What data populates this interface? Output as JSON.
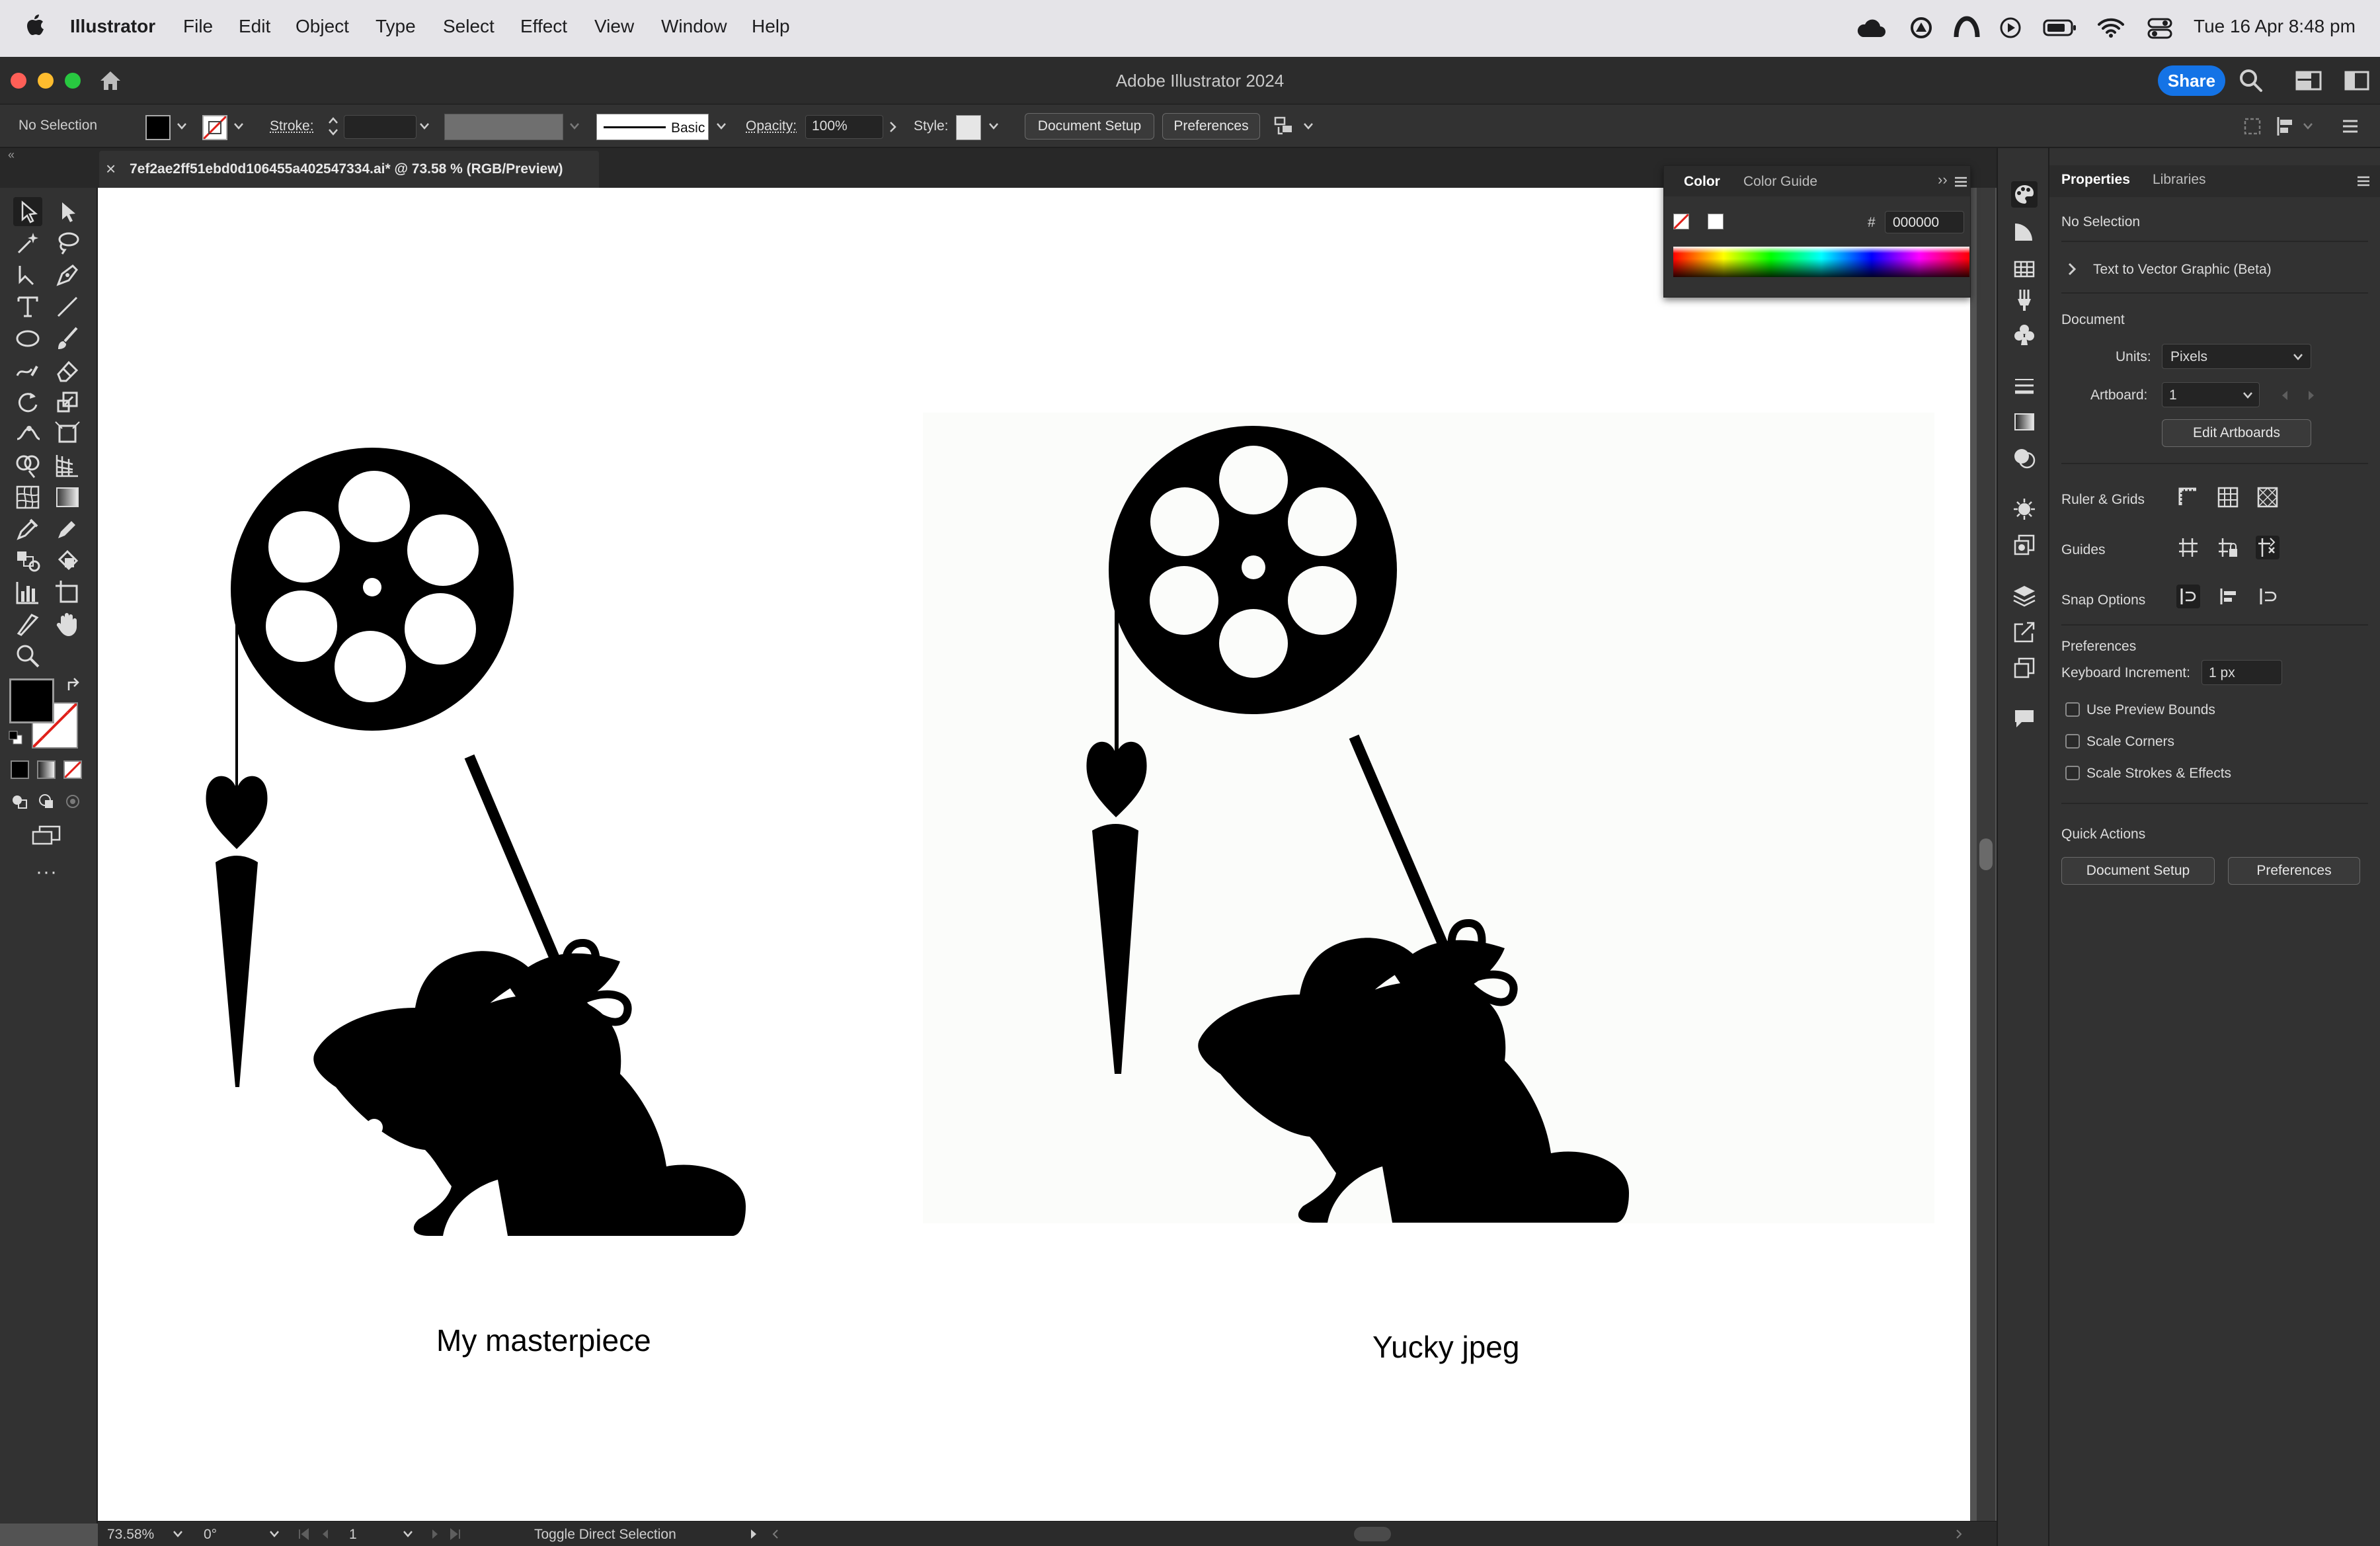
{
  "menubar": {
    "app_name": "Illustrator",
    "items": [
      "File",
      "Edit",
      "Object",
      "Type",
      "Select",
      "Effect",
      "View",
      "Window",
      "Help"
    ],
    "clock": "Tue 16 Apr  8:48 pm"
  },
  "window": {
    "title": "Adobe Illustrator 2024",
    "share_label": "Share"
  },
  "controlbar": {
    "selection_status": "No Selection",
    "stroke_label": "Stroke:",
    "brush_label": "Basic",
    "opacity_label": "Opacity:",
    "opacity_value": "100%",
    "style_label": "Style:",
    "document_setup_label": "Document Setup",
    "preferences_label": "Preferences"
  },
  "document_tab": {
    "title": "7ef2ae2ff51ebd0d106455a402547334.ai* @ 73.58 % (RGB/Preview)",
    "close_glyph": "×"
  },
  "artboard": {
    "caption_left": "My masterpiece",
    "caption_right": "Yucky jpeg"
  },
  "color_panel": {
    "tabs": [
      "Color",
      "Color Guide"
    ],
    "hash_symbol": "#",
    "hex_value": "000000"
  },
  "properties_panel": {
    "tabs": [
      "Properties",
      "Libraries"
    ],
    "selection_status": "No Selection",
    "text_to_vector": "Text to Vector Graphic (Beta)",
    "document_heading": "Document",
    "units_label": "Units:",
    "units_value": "Pixels",
    "artboard_label": "Artboard:",
    "artboard_value": "1",
    "edit_artboards_label": "Edit Artboards",
    "ruler_grids_label": "Ruler & Grids",
    "guides_label": "Guides",
    "snap_options_label": "Snap Options",
    "preferences_heading": "Preferences",
    "keyboard_increment_label": "Keyboard Increment:",
    "keyboard_increment_value": "1 px",
    "checkboxes": [
      "Use Preview Bounds",
      "Scale Corners",
      "Scale Strokes & Effects"
    ],
    "quick_actions_heading": "Quick Actions",
    "quick_document_setup": "Document Setup",
    "quick_preferences": "Preferences"
  },
  "statusbar": {
    "zoom": "73.58%",
    "rotation": "0°",
    "artboard_number": "1",
    "status_text": "Toggle Direct Selection"
  },
  "colors": {
    "accent_blue": "#1473e6",
    "panel_bg": "#323232",
    "canvas_bg": "#535353",
    "artboard_bg": "#ffffff"
  }
}
